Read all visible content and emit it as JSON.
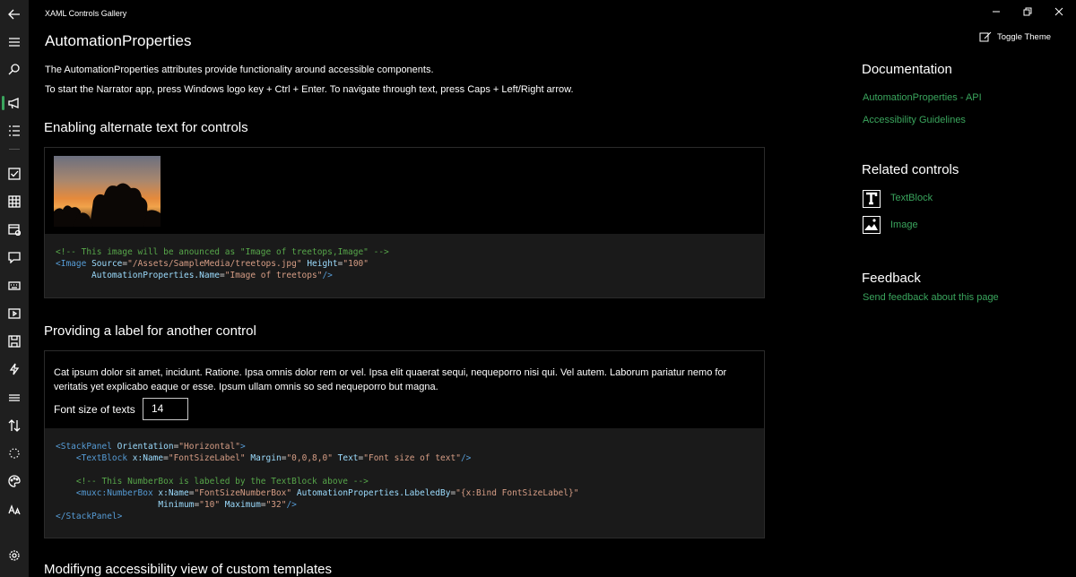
{
  "window": {
    "title": "XAML Controls Gallery"
  },
  "nav": {
    "items": [
      {
        "icon": "back-arrow-icon"
      },
      {
        "icon": "hamburger-menu-icon"
      },
      {
        "icon": "search-icon"
      },
      {
        "icon": "megaphone-icon",
        "selected": true
      },
      {
        "icon": "list-icon"
      },
      {
        "icon": "checkbox-icon"
      },
      {
        "icon": "grid-icon"
      },
      {
        "icon": "calendar-icon"
      },
      {
        "icon": "chat-icon"
      },
      {
        "icon": "keyboard-icon"
      },
      {
        "icon": "media-icon"
      },
      {
        "icon": "save-icon"
      },
      {
        "icon": "lightning-icon"
      },
      {
        "icon": "lines-icon"
      },
      {
        "icon": "sort-arrows-icon"
      },
      {
        "icon": "progress-ring-icon"
      },
      {
        "icon": "palette-icon"
      },
      {
        "icon": "font-size-icon"
      },
      {
        "icon": "settings-icon"
      }
    ],
    "accent_color": "#3aa55d"
  },
  "page": {
    "title": "AutomationProperties",
    "description": "The AutomationProperties attributes provide functionality around accessible components.",
    "narrator_hint": "To start the Narrator app, press Windows logo key + Ctrl + Enter. To navigate through text, press Caps + Left/Right arrow."
  },
  "section1": {
    "heading": "Enabling alternate text for controls",
    "code": [
      [
        {
          "t": "<!-- This image will be anounced as \"Image of treetops,Image\" -->",
          "c": "comment"
        }
      ],
      [
        {
          "t": "<",
          "c": "tag"
        },
        {
          "t": "Image",
          "c": "tag"
        },
        {
          "t": " Source",
          "c": "attr"
        },
        {
          "t": "=",
          "c": "plain"
        },
        {
          "t": "\"/Assets/SampleMedia/treetops.jpg\"",
          "c": "str"
        },
        {
          "t": " Height",
          "c": "attr"
        },
        {
          "t": "=",
          "c": "plain"
        },
        {
          "t": "\"100\"",
          "c": "str"
        }
      ],
      [
        {
          "t": "       AutomationProperties.Name",
          "c": "attr"
        },
        {
          "t": "=",
          "c": "plain"
        },
        {
          "t": "\"Image of treetops\"",
          "c": "str"
        },
        {
          "t": "/>",
          "c": "tag"
        }
      ]
    ]
  },
  "section2": {
    "heading": "Providing a label for another control",
    "paragraph": "Cat ipsum dolor sit amet, incidunt. Ratione. Ipsa omnis dolor rem or vel. Ipsa elit quaerat sequi, nequeporro nisi qui. Vel autem. Laborum pariatur nemo for veritatis yet explicabo eaque or esse. Ipsum ullam omnis so sed nequeporro but magna.",
    "font_size_label": "Font size of texts",
    "font_size_value": "14",
    "code": [
      [
        {
          "t": "<StackPanel",
          "c": "tag"
        },
        {
          "t": " Orientation",
          "c": "attr"
        },
        {
          "t": "=",
          "c": "plain"
        },
        {
          "t": "\"Horizontal\"",
          "c": "str"
        },
        {
          "t": ">",
          "c": "tag"
        }
      ],
      [
        {
          "t": "    <TextBlock",
          "c": "tag"
        },
        {
          "t": " x:Name",
          "c": "attr"
        },
        {
          "t": "=",
          "c": "plain"
        },
        {
          "t": "\"FontSizeLabel\"",
          "c": "str"
        },
        {
          "t": " Margin",
          "c": "attr"
        },
        {
          "t": "=",
          "c": "plain"
        },
        {
          "t": "\"0,0,8,0\"",
          "c": "str"
        },
        {
          "t": " Text",
          "c": "attr"
        },
        {
          "t": "=",
          "c": "plain"
        },
        {
          "t": "\"Font size of text\"",
          "c": "str"
        },
        {
          "t": "/>",
          "c": "tag"
        }
      ],
      [
        {
          "t": "",
          "c": "plain"
        }
      ],
      [
        {
          "t": "    <!-- This NumberBox is labeled by the TextBlock above -->",
          "c": "comment"
        }
      ],
      [
        {
          "t": "    <muxc:NumberBox",
          "c": "tag"
        },
        {
          "t": " x:Name",
          "c": "attr"
        },
        {
          "t": "=",
          "c": "plain"
        },
        {
          "t": "\"FontSizeNumberBox\"",
          "c": "str"
        },
        {
          "t": " AutomationProperties.LabeledBy",
          "c": "attr"
        },
        {
          "t": "=",
          "c": "plain"
        },
        {
          "t": "\"{x:Bind FontSizeLabel}\"",
          "c": "str"
        }
      ],
      [
        {
          "t": "                    Minimum",
          "c": "attr"
        },
        {
          "t": "=",
          "c": "plain"
        },
        {
          "t": "\"10\"",
          "c": "str"
        },
        {
          "t": " Maximum",
          "c": "attr"
        },
        {
          "t": "=",
          "c": "plain"
        },
        {
          "t": "\"32\"",
          "c": "str"
        },
        {
          "t": "/>",
          "c": "tag"
        }
      ],
      [
        {
          "t": "</StackPanel>",
          "c": "tag"
        }
      ]
    ]
  },
  "section3": {
    "heading": "Modifiyng accessibility view of custom templates"
  },
  "right_pane": {
    "toggle_theme": "Toggle Theme",
    "documentation_heading": "Documentation",
    "doc_links": [
      "AutomationProperties - API",
      "Accessibility Guidelines"
    ],
    "related_heading": "Related controls",
    "related": [
      {
        "label": "TextBlock",
        "icon": "textblock-icon"
      },
      {
        "label": "Image",
        "icon": "image-icon"
      }
    ],
    "feedback_heading": "Feedback",
    "feedback_link": "Send feedback about this page",
    "link_color": "#3aa55d"
  }
}
